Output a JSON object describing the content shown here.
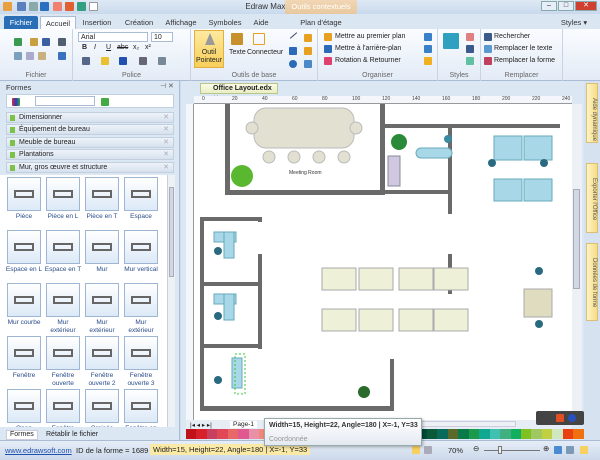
{
  "window": {
    "title": "Edraw Max - Office Layout.edx",
    "context_tab": "Outils contextuels",
    "styles_label": "Styles"
  },
  "tabs": [
    "Fichier",
    "Accueil",
    "Insertion",
    "Création",
    "Affichage",
    "Symboles",
    "Aide",
    "Plan d'étage"
  ],
  "ribbon": {
    "groups": {
      "fichier": "Fichier",
      "police": "Police",
      "outils": "Outils de base",
      "organiser": "Organiser",
      "styles": "Styles",
      "remplacer": "Remplacer"
    },
    "font_name": "Arial",
    "font_size": "10",
    "format_buttons": [
      "B",
      "I",
      "U",
      "abc",
      "x₂",
      "x²"
    ],
    "pointer_tool": "Outil Pointeur",
    "text_tool": "Texte",
    "connector_tool": "Connecteur",
    "bring_front": "Mettre au premier plan",
    "send_back": "Mettre à l'arrière-plan",
    "rotate": "Rotation & Retourner",
    "find": "Rechercher",
    "replace_text": "Remplacer le texte",
    "replace_shape": "Remplacer la forme"
  },
  "shapes_panel": {
    "title": "Formes",
    "categories": [
      "Dimensionner",
      "Équipement de bureau",
      "Meuble de bureau",
      "Plantations",
      "Mur, gros œuvre et structure"
    ],
    "shapes": [
      "Pièce",
      "Pièce en L",
      "Pièce en T",
      "Espace",
      "Espace en L",
      "Espace en T",
      "Mur",
      "Mur vertical",
      "Mur courbe",
      "Mur extérieur",
      "Mur extérieur",
      "Mur extérieur",
      "Fenêtre",
      "Fenêtre ouverte",
      "Fenêtre ouverte 2",
      "Fenêtre ouverte 3",
      "Open",
      "Fenêtre",
      "Croisée",
      "Fenêtre en"
    ],
    "bottom_tabs": [
      "Formes",
      "Rétablir le fichier"
    ]
  },
  "document": {
    "tab": "Office Layout.edx",
    "page": "Page-1",
    "room_label": "Meeting Room",
    "ruler_ticks": [
      "0",
      "20",
      "40",
      "60",
      "80",
      "100",
      "120",
      "140",
      "160",
      "180",
      "200",
      "220",
      "240"
    ]
  },
  "right_panel": [
    "Aide dynamique",
    "Exporter l'Office",
    "Données de forme"
  ],
  "tooltip": {
    "text": "Width=15, Height=22, Angle=180 | X=-1, Y=33",
    "label": "Coordonnée"
  },
  "status": {
    "link": "www.edrawsoft.com",
    "shape_id": "ID de la forme = 1689",
    "info": "Width=15, Height=22, Angle=180 | X=-1, Y=33",
    "zoom": "70%"
  },
  "palette": [
    "#c0101a",
    "#d8202a",
    "#c84060",
    "#e04858",
    "#e86868",
    "#e05890",
    "#e890a8",
    "#f08878",
    "#f0a080",
    "#f0b090",
    "#e0e0ea",
    "#e2e4ee",
    "#e4e6f0",
    "#e0e4f0",
    "#dde6f2",
    "#dae6f2",
    "#d8e8f4",
    "#d6e8f6",
    "#d4e6f6",
    "#d0e4f4",
    "#cfe6f6",
    "#b8dcf0",
    "#004a38",
    "#0a5a3a",
    "#0a6a5a",
    "#5a6a2a",
    "#0a7a4a",
    "#1a9a4a",
    "#10a890",
    "#40c0b0",
    "#40b080",
    "#10b060",
    "#80c020",
    "#a0c860",
    "#c0d040",
    "#d0e8c0",
    "#e84010",
    "#f07010"
  ]
}
